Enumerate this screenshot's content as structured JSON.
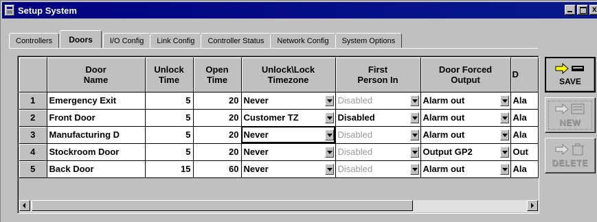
{
  "window": {
    "title": "Setup System"
  },
  "tabs": [
    {
      "label": "Controllers",
      "active": false
    },
    {
      "label": "Doors",
      "active": true
    },
    {
      "label": "I/O Config",
      "active": false
    },
    {
      "label": "Link Config",
      "active": false
    },
    {
      "label": "Controller Status",
      "active": false
    },
    {
      "label": "Network Config",
      "active": false
    },
    {
      "label": "System Options",
      "active": false
    }
  ],
  "grid": {
    "headers": [
      "Door\nName",
      "Unlock\nTime",
      "Open\nTime",
      "Unlock\\Lock\nTimezone",
      "First\nPerson In",
      "Door Forced\nOutput",
      "D"
    ],
    "rows": [
      {
        "num": "1",
        "name": "Emergency Exit",
        "unlock": "5",
        "open": "20",
        "timezone": "Never",
        "first": "Disabled",
        "forced": "Alarm out",
        "extra": "Ala"
      },
      {
        "num": "2",
        "name": "Front Door",
        "unlock": "5",
        "open": "20",
        "timezone": "Customer TZ",
        "first": "Disabled",
        "forced": "Alarm out",
        "extra": "Ala"
      },
      {
        "num": "3",
        "name": "Manufacturing D",
        "unlock": "5",
        "open": "20",
        "timezone": "Never",
        "first": "Disabled",
        "forced": "Alarm out",
        "extra": "Ala"
      },
      {
        "num": "4",
        "name": "Stockroom Door",
        "unlock": "5",
        "open": "20",
        "timezone": "Never",
        "first": "Disabled",
        "forced": "Output GP2",
        "extra": "Out"
      },
      {
        "num": "5",
        "name": "Back Door",
        "unlock": "15",
        "open": "60",
        "timezone": "Never",
        "first": "Disabled",
        "forced": "Alarm out",
        "extra": "Ala"
      }
    ],
    "first_person_enabled_rows": [
      2
    ]
  },
  "buttons": {
    "save": "SAVE",
    "new": "NEW",
    "delete": "DELETE"
  },
  "colors": {
    "titlebar": "#000080",
    "face": "#c0c0c0",
    "disabled_text": "#9a9a9a",
    "arrow_yellow": "#ffff00"
  }
}
